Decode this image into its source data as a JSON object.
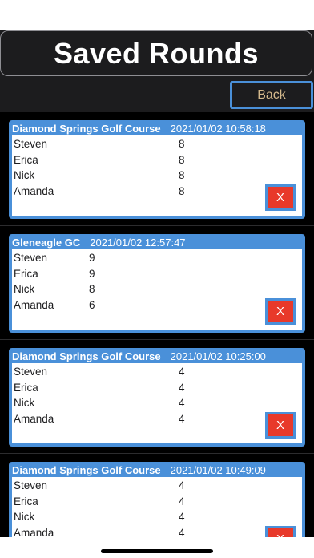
{
  "header": {
    "title": "Saved Rounds"
  },
  "toolbar": {
    "back_label": "Back"
  },
  "rounds": [
    {
      "course": "Diamond Springs Golf Course",
      "date": "2021/01/02 10:58:18",
      "players": [
        {
          "name": "Steven",
          "score": "8"
        },
        {
          "name": "Erica",
          "score": "8"
        },
        {
          "name": "Nick",
          "score": "8"
        },
        {
          "name": "Amanda",
          "score": "8"
        }
      ],
      "delete_label": "X"
    },
    {
      "course": "Gleneagle GC",
      "date": "2021/01/02 12:57:47",
      "players": [
        {
          "name": "Steven",
          "score": "9"
        },
        {
          "name": "Erica",
          "score": "9"
        },
        {
          "name": "Nick",
          "score": "8"
        },
        {
          "name": "Amanda",
          "score": "6"
        }
      ],
      "delete_label": "X"
    },
    {
      "course": "Diamond Springs Golf Course",
      "date": "2021/01/02 10:25:00",
      "players": [
        {
          "name": "Steven",
          "score": "4"
        },
        {
          "name": "Erica",
          "score": "4"
        },
        {
          "name": "Nick",
          "score": "4"
        },
        {
          "name": "Amanda",
          "score": "4"
        }
      ],
      "delete_label": "X"
    },
    {
      "course": "Diamond Springs Golf Course",
      "date": "2021/01/02 10:49:09",
      "players": [
        {
          "name": "Steven",
          "score": "4"
        },
        {
          "name": "Erica",
          "score": "4"
        },
        {
          "name": "Nick",
          "score": "4"
        },
        {
          "name": "Amanda",
          "score": "4"
        }
      ],
      "delete_label": "X"
    }
  ],
  "colors": {
    "accent": "#4a90d9",
    "delete": "#e8392a",
    "back_text": "#d4b98c",
    "background": "#1c1c1e"
  }
}
